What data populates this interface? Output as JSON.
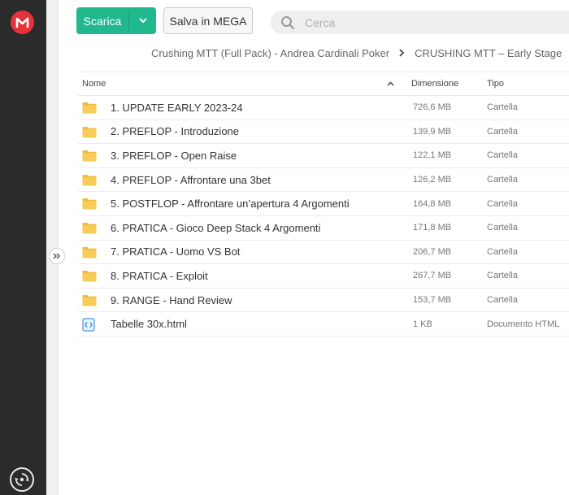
{
  "sidebar": {
    "logo_icon": "mega-logo-icon",
    "logo_letter": "M",
    "bottom_icon": "sync-icon"
  },
  "colors": {
    "sidebar_bg": "#2b2b2b",
    "brand_red": "#e5333a",
    "accent_green": "#21b88e",
    "folder_yellow": "#f5c342"
  },
  "toolbar": {
    "download_label": "Scarica",
    "download_dropdown_icon": "chevron-down-icon",
    "save_label": "Salva in MEGA"
  },
  "search": {
    "placeholder": "Cerca",
    "value": ""
  },
  "breadcrumb": {
    "parent": "Crushing MTT (Full Pack) - Andrea Cardinali Poker",
    "separator_icon": "chevron-right-icon",
    "current": "CRUSHING MTT – Early Stage"
  },
  "table": {
    "headers": {
      "name": "Nome",
      "size": "Dimensione",
      "type": "Tipo"
    },
    "sort_direction": "ascending",
    "rows": [
      {
        "icon": "folder-icon",
        "name": "1. UPDATE EARLY 2023-24",
        "size": "726,6 MB",
        "type": "Cartella"
      },
      {
        "icon": "folder-icon",
        "name": "2. PREFLOP - Introduzione",
        "size": "139,9 MB",
        "type": "Cartella"
      },
      {
        "icon": "folder-icon",
        "name": "3. PREFLOP - Open Raise",
        "size": "122,1 MB",
        "type": "Cartella"
      },
      {
        "icon": "folder-icon",
        "name": "4. PREFLOP - Affrontare una 3bet",
        "size": "126,2 MB",
        "type": "Cartella"
      },
      {
        "icon": "folder-icon",
        "name": "5. POSTFLOP - Affrontare un’apertura 4 Argomenti",
        "size": "164,8 MB",
        "type": "Cartella"
      },
      {
        "icon": "folder-icon",
        "name": "6. PRATICA - Gioco Deep Stack 4 Argomenti",
        "size": "171,8 MB",
        "type": "Cartella"
      },
      {
        "icon": "folder-icon",
        "name": "7. PRATICA - Uomo VS Bot",
        "size": "206,7 MB",
        "type": "Cartella"
      },
      {
        "icon": "folder-icon",
        "name": "8. PRATICA - Exploit",
        "size": "267,7 MB",
        "type": "Cartella"
      },
      {
        "icon": "folder-icon",
        "name": "9. RANGE - Hand Review",
        "size": "153,7 MB",
        "type": "Cartella"
      },
      {
        "icon": "html-file-icon",
        "name": "Tabelle 30x.html",
        "size": "1 KB",
        "type": "Documento HTML"
      }
    ]
  }
}
